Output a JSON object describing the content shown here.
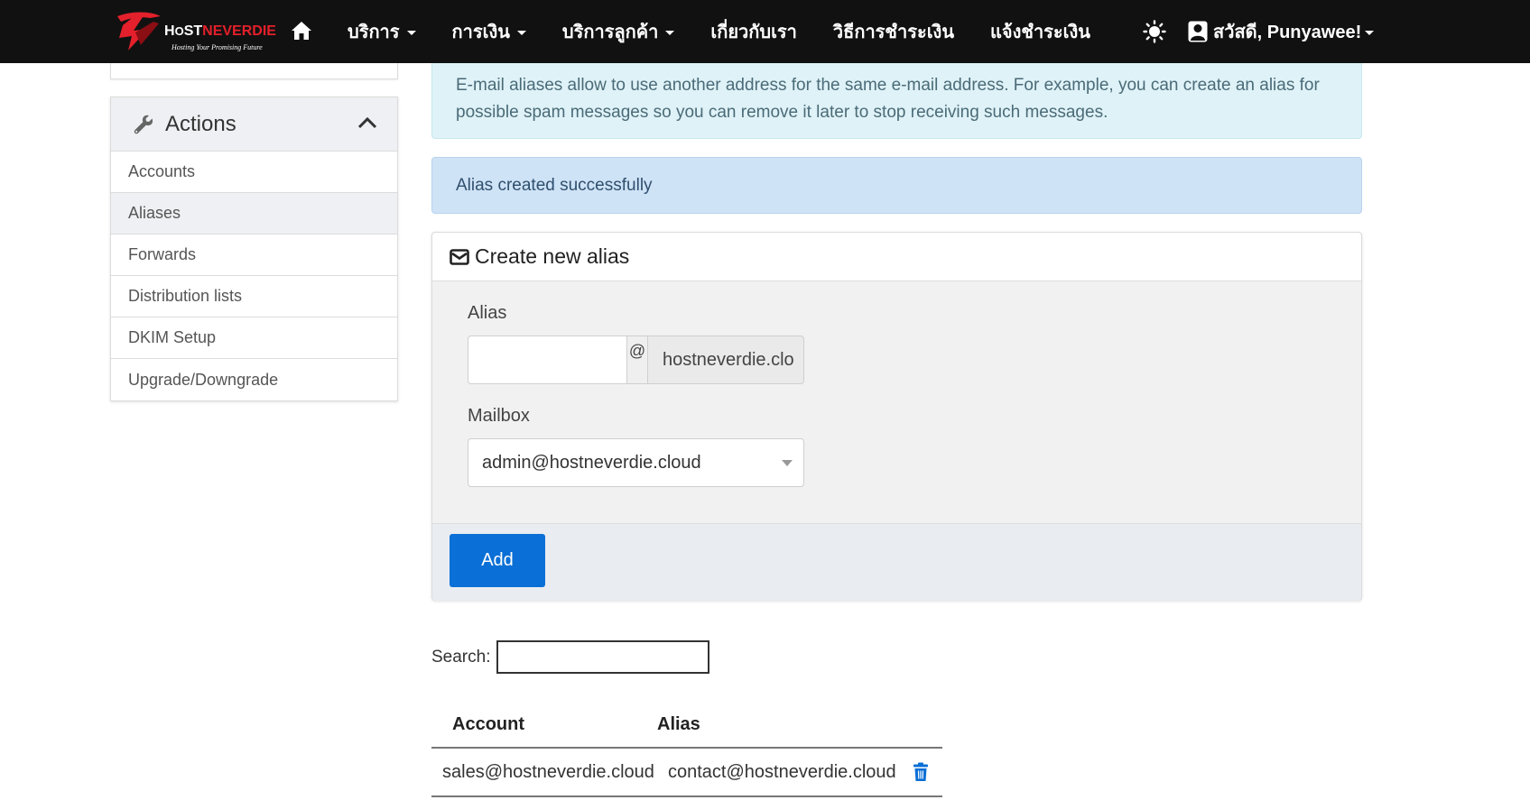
{
  "navbar": {
    "brand": {
      "name_prefix": "H",
      "name_mid": "ST",
      "name_suffix": "NEVERDIE",
      "tagline": "Hosting Your Promising Future"
    },
    "items": [
      {
        "label": "บริการ",
        "dropdown": true
      },
      {
        "label": "การเงิน",
        "dropdown": true
      },
      {
        "label": "บริการลูกค้า",
        "dropdown": true
      },
      {
        "label": "เกี่ยวกับเรา",
        "dropdown": false
      },
      {
        "label": "วิธีการชำระเงิน",
        "dropdown": false
      },
      {
        "label": "แจ้งชำระเงิน",
        "dropdown": false
      }
    ],
    "user_greeting": "สวัสดี, Punyawee!"
  },
  "sidebar": {
    "actions_title": "Actions",
    "items": [
      {
        "label": "Accounts",
        "active": false
      },
      {
        "label": "Aliases",
        "active": true
      },
      {
        "label": "Forwards",
        "active": false
      },
      {
        "label": "Distribution lists",
        "active": false
      },
      {
        "label": "DKIM Setup",
        "active": false
      },
      {
        "label": "Upgrade/Downgrade",
        "active": false
      }
    ]
  },
  "main": {
    "info_text": "E-mail aliases allow to use another address for the same e-mail address. For example, you can create an alias for possible spam messages so you can remove it later to stop receiving such messages.",
    "success_text": "Alias created successfully",
    "form": {
      "title": "Create new alias",
      "alias_label": "Alias",
      "alias_value": "",
      "at_symbol": "@",
      "domain": "hostneverdie.clo",
      "mailbox_label": "Mailbox",
      "mailbox_value": "admin@hostneverdie.cloud",
      "add_label": "Add"
    },
    "search_label": "Search:",
    "table": {
      "columns": [
        "Account",
        "Alias"
      ],
      "rows": [
        {
          "account": "sales@hostneverdie.cloud",
          "alias": "contact@hostneverdie.cloud"
        }
      ]
    }
  },
  "colors": {
    "primary": "#0a6fd6",
    "navbar": "#111111",
    "brand_red": "#e3202b",
    "info_bg": "#dff2f7",
    "success_bg": "#cfe3f6"
  }
}
